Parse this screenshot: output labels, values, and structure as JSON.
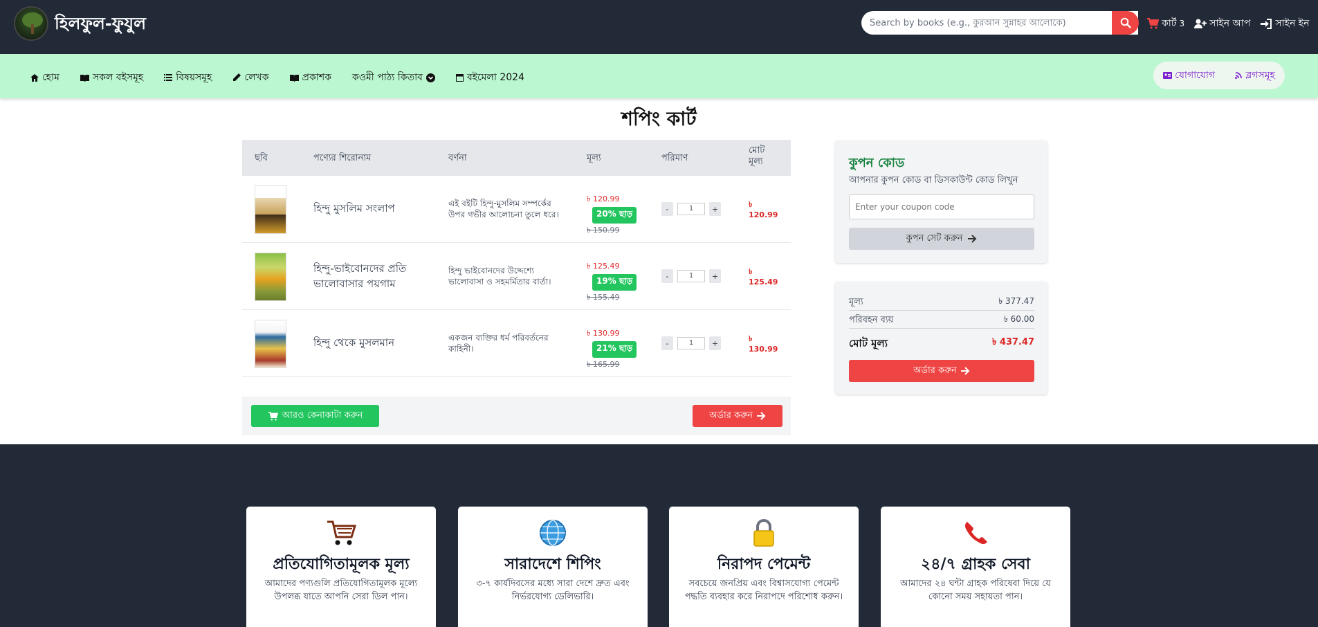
{
  "header": {
    "brand": "হিলফুল-ফুযুল",
    "search_placeholder": "Search by books (e.g., কুরআন সুন্নাহর আলোকে)",
    "cart_label": "কার্ট",
    "cart_count": "3",
    "signup": "সাইন আপ",
    "signin": "সাইন ইন"
  },
  "nav": {
    "items": [
      "হোম",
      "সকল বইসমূহ",
      "বিষয়সমূহ",
      "লেখক",
      "প্রকাশক",
      "কওমী পাঠ্য কিতাব",
      "বইমেলা 2024"
    ],
    "contact": "যোগাযোগ",
    "blogs": "ব্লগসমূহ"
  },
  "page_title": "শপিং কার্ট",
  "table": {
    "headers": [
      "ছবি",
      "পণ্যের শিরোনাম",
      "বর্ণনা",
      "মূল্য",
      "পরিমাণ",
      "মোট মূল্য"
    ],
    "rows": [
      {
        "title": "হিন্দু মুসলিম সংলাপ",
        "desc": "এই বইটি হিন্দু-মুসলিম সম্পর্কের উপর গভীর আলোচনা তুলে ধরে।",
        "price": "৳ 120.99",
        "discount": "20% ছাড়",
        "old_price": "৳ 150.99",
        "qty": "1",
        "total": "৳ 120.99"
      },
      {
        "title": "হিন্দু-ভাইবোনদের প্রতি ভালোবাসার পয়গাম",
        "desc": "হিন্দু ভাইবোনদের উদ্দেশ্যে ভালোবাসা ও সহমর্মিতার বার্তা।",
        "price": "৳ 125.49",
        "discount": "19% ছাড়",
        "old_price": "৳ 155.49",
        "qty": "1",
        "total": "৳ 125.49"
      },
      {
        "title": "হিন্দু থেকে মুসলমান",
        "desc": "একজন ব্যক্তির ধর্ম পরিবর্তনের কাহিনী।",
        "price": "৳ 130.99",
        "discount": "21% ছাড়",
        "old_price": "৳ 165.99",
        "qty": "1",
        "total": "৳ 130.99"
      }
    ],
    "qty_minus": "-",
    "qty_plus": "+"
  },
  "actions": {
    "continue_shopping": "আরও কেনাকাটা করুন",
    "order": "অর্ডার করুন"
  },
  "coupon": {
    "title": "কুপন কোড",
    "subtitle": "আপনার কুপন কোড বা ডিসকাউন্ট কোড লিখুন",
    "placeholder": "Enter your coupon code",
    "button": "কুপন সেট করুন"
  },
  "summary": {
    "price_label": "মূল্য",
    "price_value": "৳ 377.47",
    "shipping_label": "পরিবহন ব্যয়",
    "shipping_value": "৳ 60.00",
    "total_label": "মোট মূল্য",
    "total_value": "৳ 437.47",
    "order_button": "অর্ডার করুন"
  },
  "features": [
    {
      "icon": "shopping-cart-icon",
      "title": "প্রতিযোগিতামূলক মূল্য",
      "desc": "আমাদের পণ্যগুলি প্রতিযোগিতামূলক মূল্যে উপলব্ধ যাতে আপনি সেরা ডিল পান।"
    },
    {
      "icon": "globe-icon",
      "title": "সারাদেশে শিপিং",
      "desc": "৩-৭ কার্যদিবসের মধ্যে সারা দেশে দ্রুত এবং নির্ভরযোগ্য ডেলিভারি।"
    },
    {
      "icon": "lock-icon",
      "title": "নিরাপদ পেমেন্ট",
      "desc": "সবচেয়ে জনপ্রিয় এবং বিশ্বাসযোগ্য পেমেন্ট পদ্ধতি ব্যবহার করে নিরাপদে পরিশোধ করুন।"
    },
    {
      "icon": "phone-icon",
      "title": "২৪/৭ গ্রাহক সেবা",
      "desc": "আমাদের ২৪ ঘন্টা গ্রাহক পরিষেবা দিয়ে যে কোনো সময় সহায়তা পান।"
    }
  ],
  "colors": {
    "header_bg": "#222a38",
    "nav_bg": "#bbf7d0",
    "accent_red": "#ef4444",
    "accent_green": "#22c55e"
  }
}
